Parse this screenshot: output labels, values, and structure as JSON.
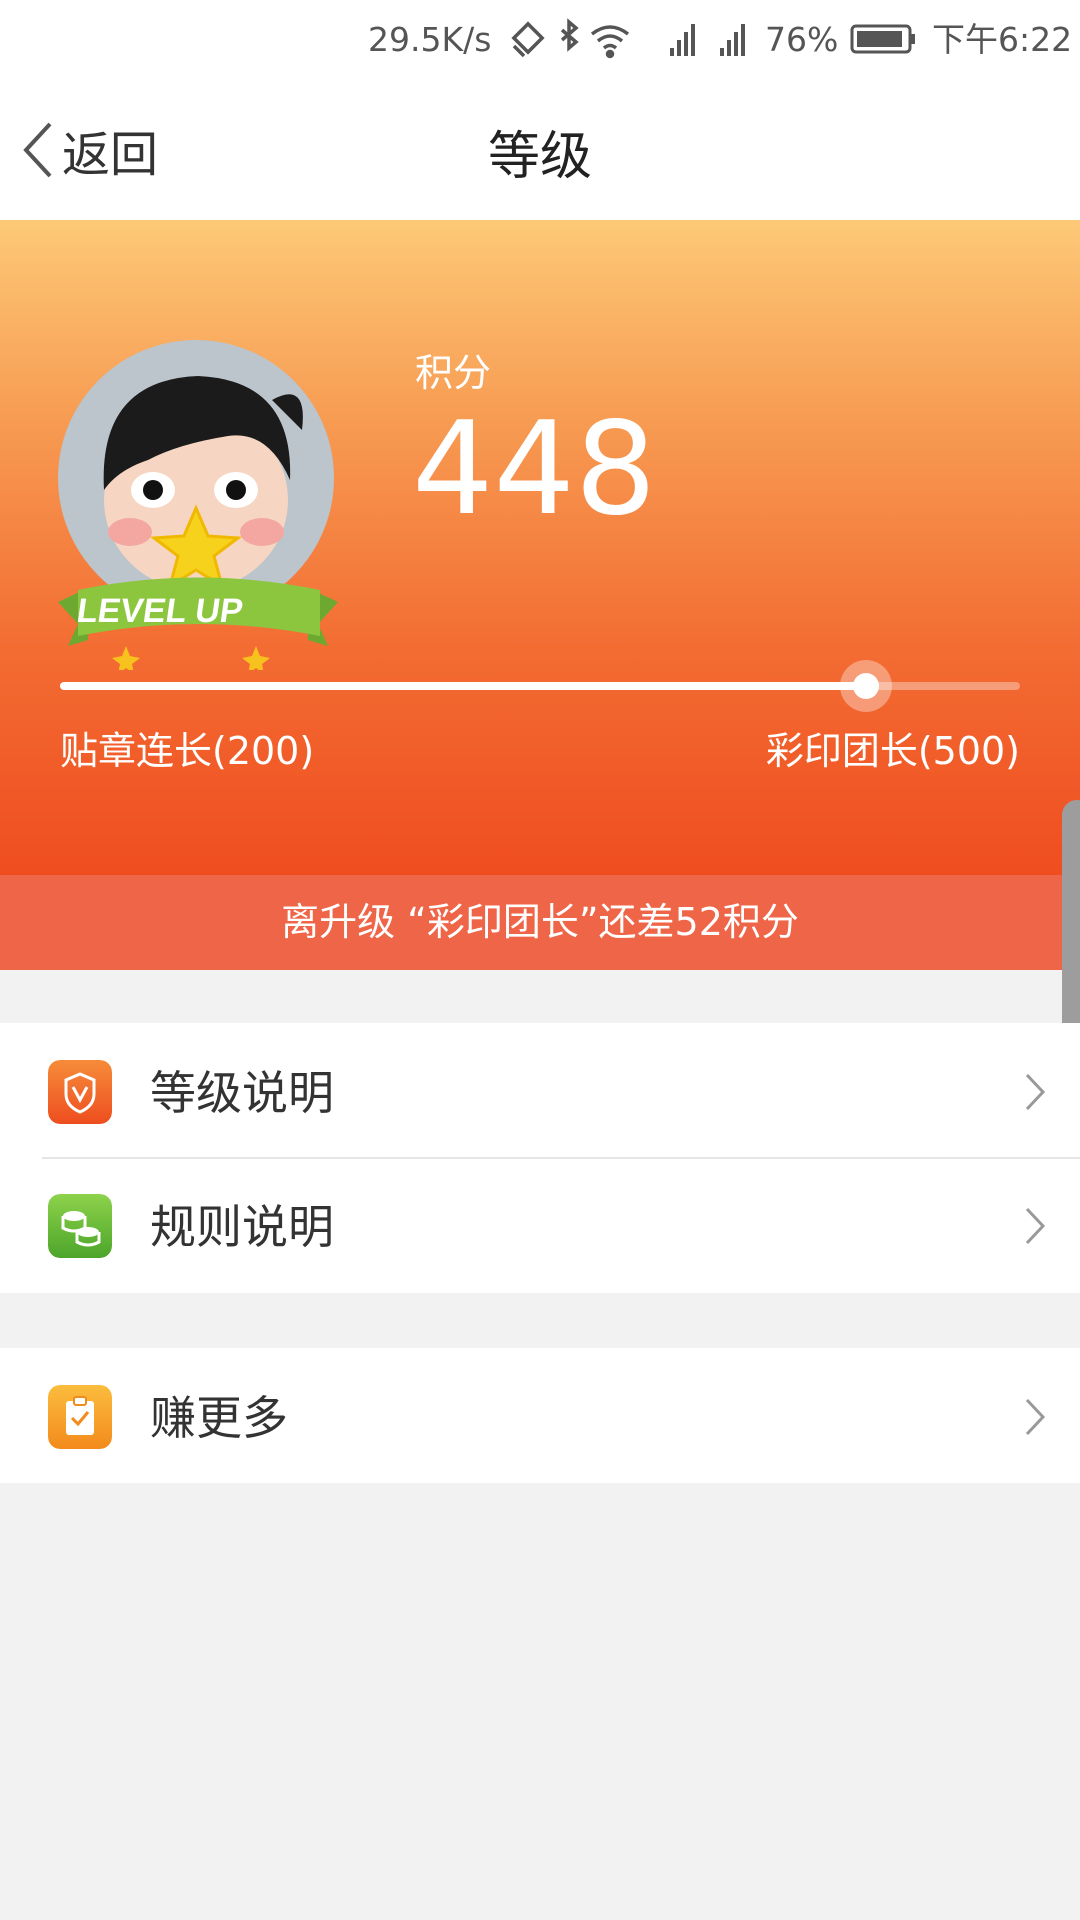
{
  "status_bar": {
    "speed": "29.5K/s",
    "battery": "76%",
    "time": "下午6:22"
  },
  "nav": {
    "back_label": "返回",
    "title": "等级"
  },
  "hero": {
    "points_label": "积分",
    "points_value": "448",
    "avatar_badge": "LEVEL UP",
    "progress_fraction": 0.84,
    "level_current": "贴章连长(200)",
    "level_next": "彩印团长(500)"
  },
  "banner": {
    "text": "离升级 “彩印团长”还差52积分"
  },
  "menu": {
    "items": [
      {
        "label": "等级说明",
        "icon": "shield-v-icon",
        "color": "#f05a28"
      },
      {
        "label": "规则说明",
        "icon": "coins-stack-icon",
        "color": "#5cb531"
      },
      {
        "label": "赚更多",
        "icon": "clipboard-check-icon",
        "color": "#f39a22"
      }
    ]
  },
  "colors": {
    "hero_top": "#fdc977",
    "hero_bottom": "#ef4d20",
    "banner": "#ef6548"
  }
}
